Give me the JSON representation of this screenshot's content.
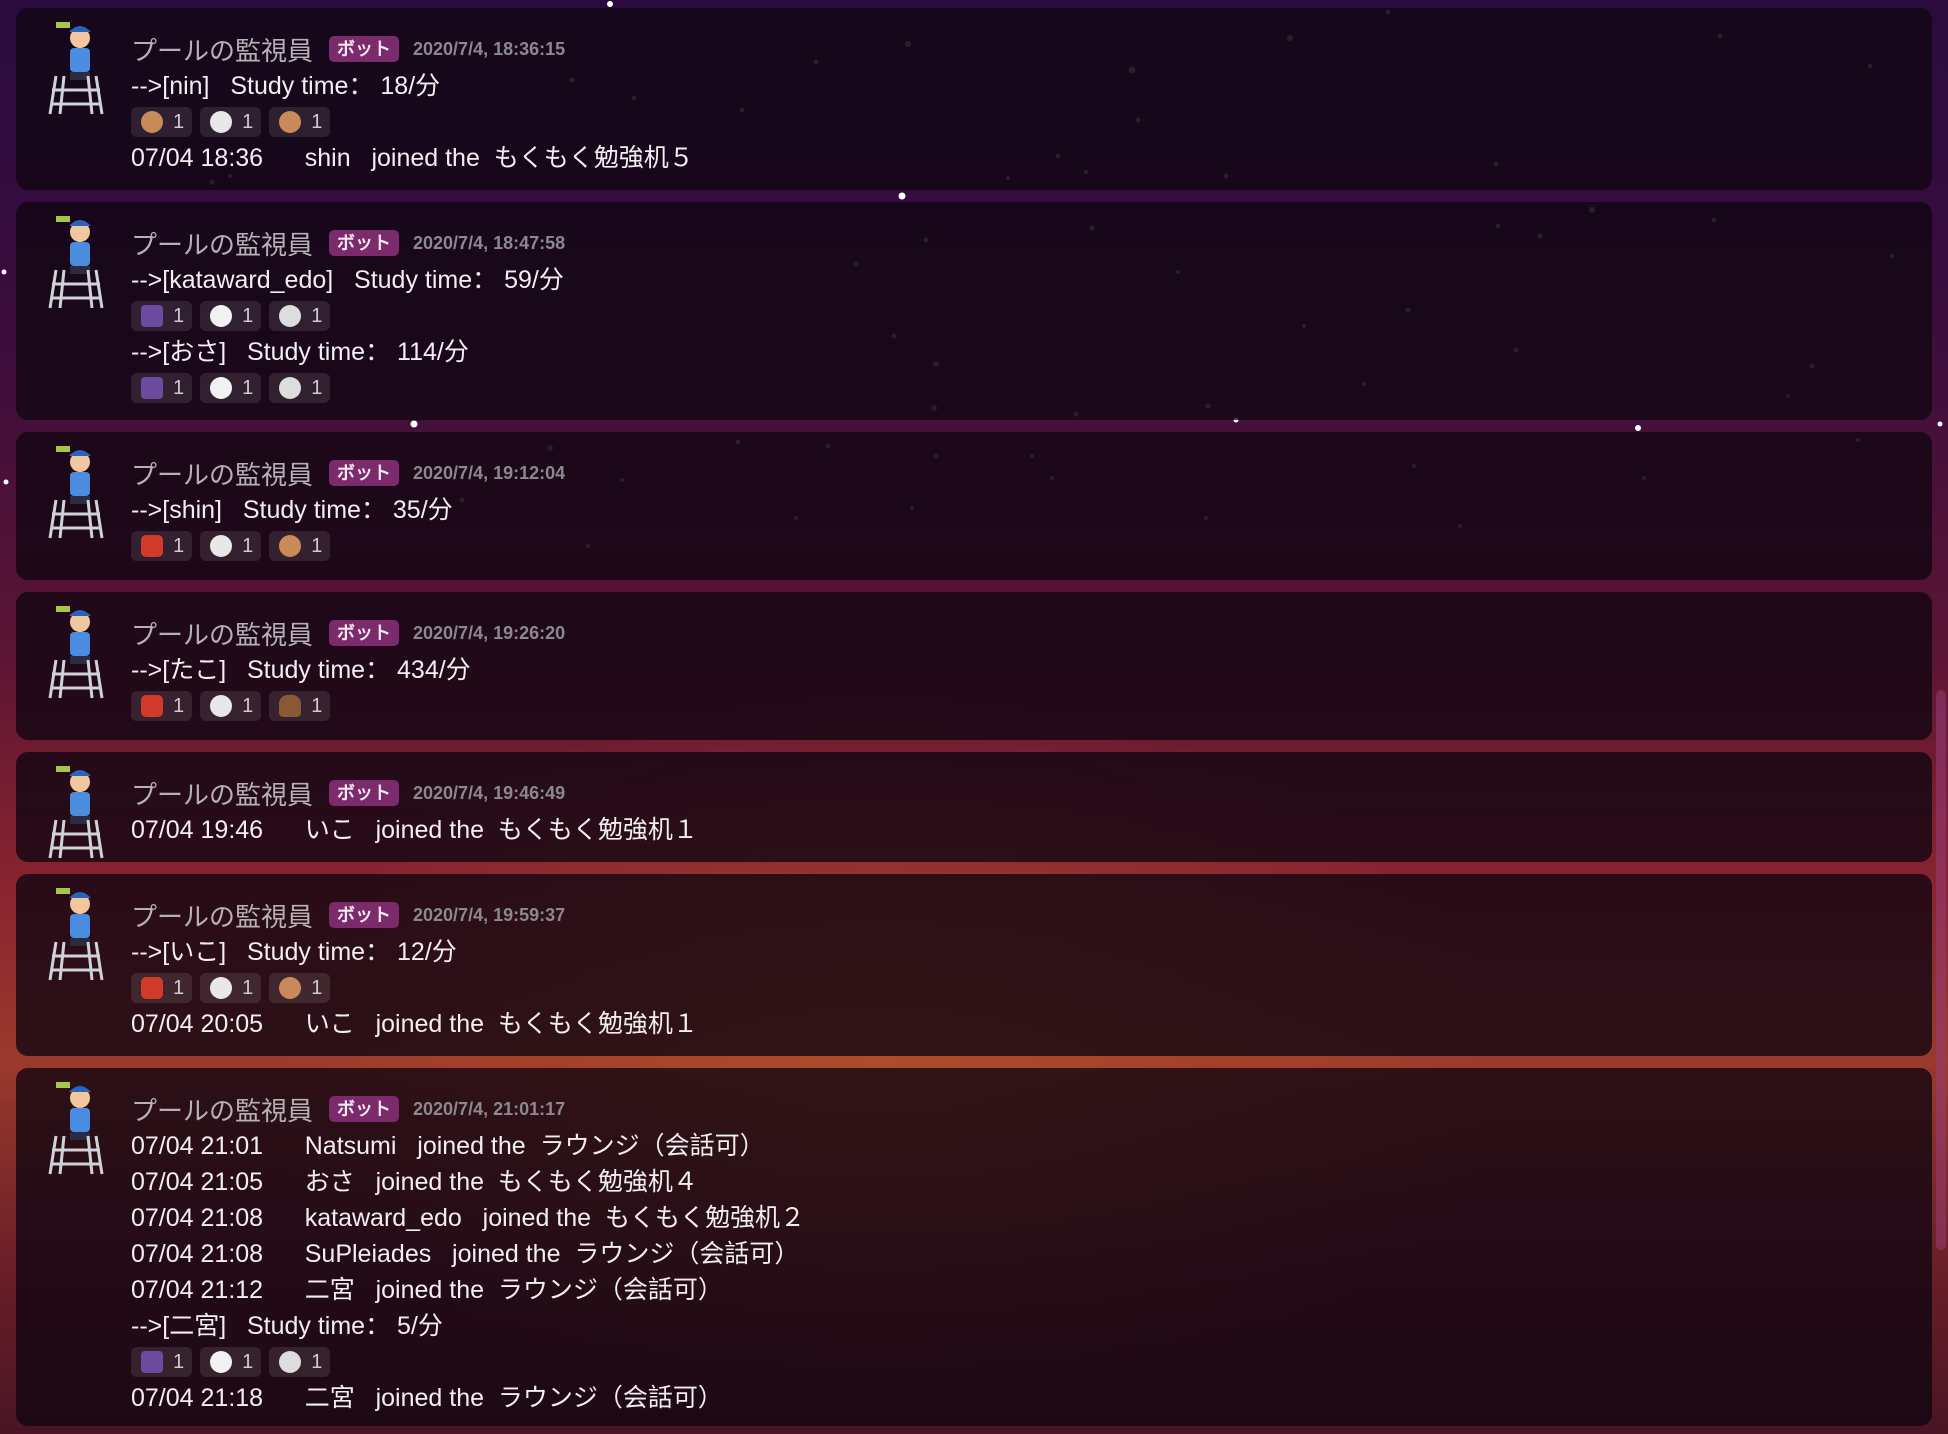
{
  "messages": [
    {
      "author": "プールの監視員",
      "badge": "ボット",
      "timestamp": "2020/7/4, 18:36:15",
      "lines": [
        "-->[nin]   Study time： 18/分"
      ],
      "reactions": [
        {
          "icon": "see-no-evil-monkey",
          "count": "1"
        },
        {
          "icon": "skull",
          "count": "1"
        },
        {
          "icon": "see-no-evil-monkey",
          "count": "1"
        }
      ],
      "after": [
        "07/04 18:36      shin   joined the  もくもく勉強机５"
      ]
    },
    {
      "author": "プールの監視員",
      "badge": "ボット",
      "timestamp": "2020/7/4, 18:47:58",
      "lines": [
        "-->[kataward_edo]   Study time： 59/分"
      ],
      "reactions": [
        {
          "icon": "alien-monster",
          "count": "1"
        },
        {
          "icon": "clown",
          "count": "1"
        },
        {
          "icon": "ghost",
          "count": "1"
        }
      ],
      "lines2": [
        "-->[おさ]   Study time： 114/分"
      ],
      "reactions2": [
        {
          "icon": "alien-monster",
          "count": "1"
        },
        {
          "icon": "clown",
          "count": "1"
        },
        {
          "icon": "ghost",
          "count": "1"
        }
      ]
    },
    {
      "author": "プールの監視員",
      "badge": "ボット",
      "timestamp": "2020/7/4, 19:12:04",
      "lines": [
        "-->[shin]   Study time： 35/分"
      ],
      "reactions": [
        {
          "icon": "ogre",
          "count": "1"
        },
        {
          "icon": "skull",
          "count": "1"
        },
        {
          "icon": "see-no-evil-monkey",
          "count": "1"
        }
      ]
    },
    {
      "author": "プールの監視員",
      "badge": "ボット",
      "timestamp": "2020/7/4, 19:26:20",
      "lines": [
        "-->[たこ]   Study time： 434/分"
      ],
      "reactions": [
        {
          "icon": "ogre",
          "count": "1"
        },
        {
          "icon": "skull",
          "count": "1"
        },
        {
          "icon": "poop",
          "count": "1"
        }
      ]
    },
    {
      "author": "プールの監視員",
      "badge": "ボット",
      "timestamp": "2020/7/4, 19:46:49",
      "lines": [
        "07/04 19:46      いこ   joined the  もくもく勉強机１"
      ]
    },
    {
      "author": "プールの監視員",
      "badge": "ボット",
      "timestamp": "2020/7/4, 19:59:37",
      "lines": [
        "-->[いこ]   Study time： 12/分"
      ],
      "reactions": [
        {
          "icon": "ogre",
          "count": "1"
        },
        {
          "icon": "skull",
          "count": "1"
        },
        {
          "icon": "see-no-evil-monkey",
          "count": "1"
        }
      ],
      "after": [
        "07/04 20:05      いこ   joined the  もくもく勉強机１"
      ]
    },
    {
      "author": "プールの監視員",
      "badge": "ボット",
      "timestamp": "2020/7/4, 21:01:17",
      "lines": [
        "07/04 21:01      Natsumi   joined the  ラウンジ（会話可）",
        "07/04 21:05      おさ   joined the  もくもく勉強机４",
        "07/04 21:08      kataward_edo   joined the  もくもく勉強机２",
        "07/04 21:08      SuPleiades   joined the  ラウンジ（会話可）",
        "07/04 21:12      二宮   joined the  ラウンジ（会話可）",
        "-->[二宮]   Study time： 5/分"
      ],
      "reactions": [
        {
          "icon": "alien-monster",
          "count": "1"
        },
        {
          "icon": "clown",
          "count": "1"
        },
        {
          "icon": "ghost",
          "count": "1"
        }
      ],
      "after": [
        "07/04 21:18      二宮   joined the  ラウンジ（会話可）"
      ]
    }
  ]
}
